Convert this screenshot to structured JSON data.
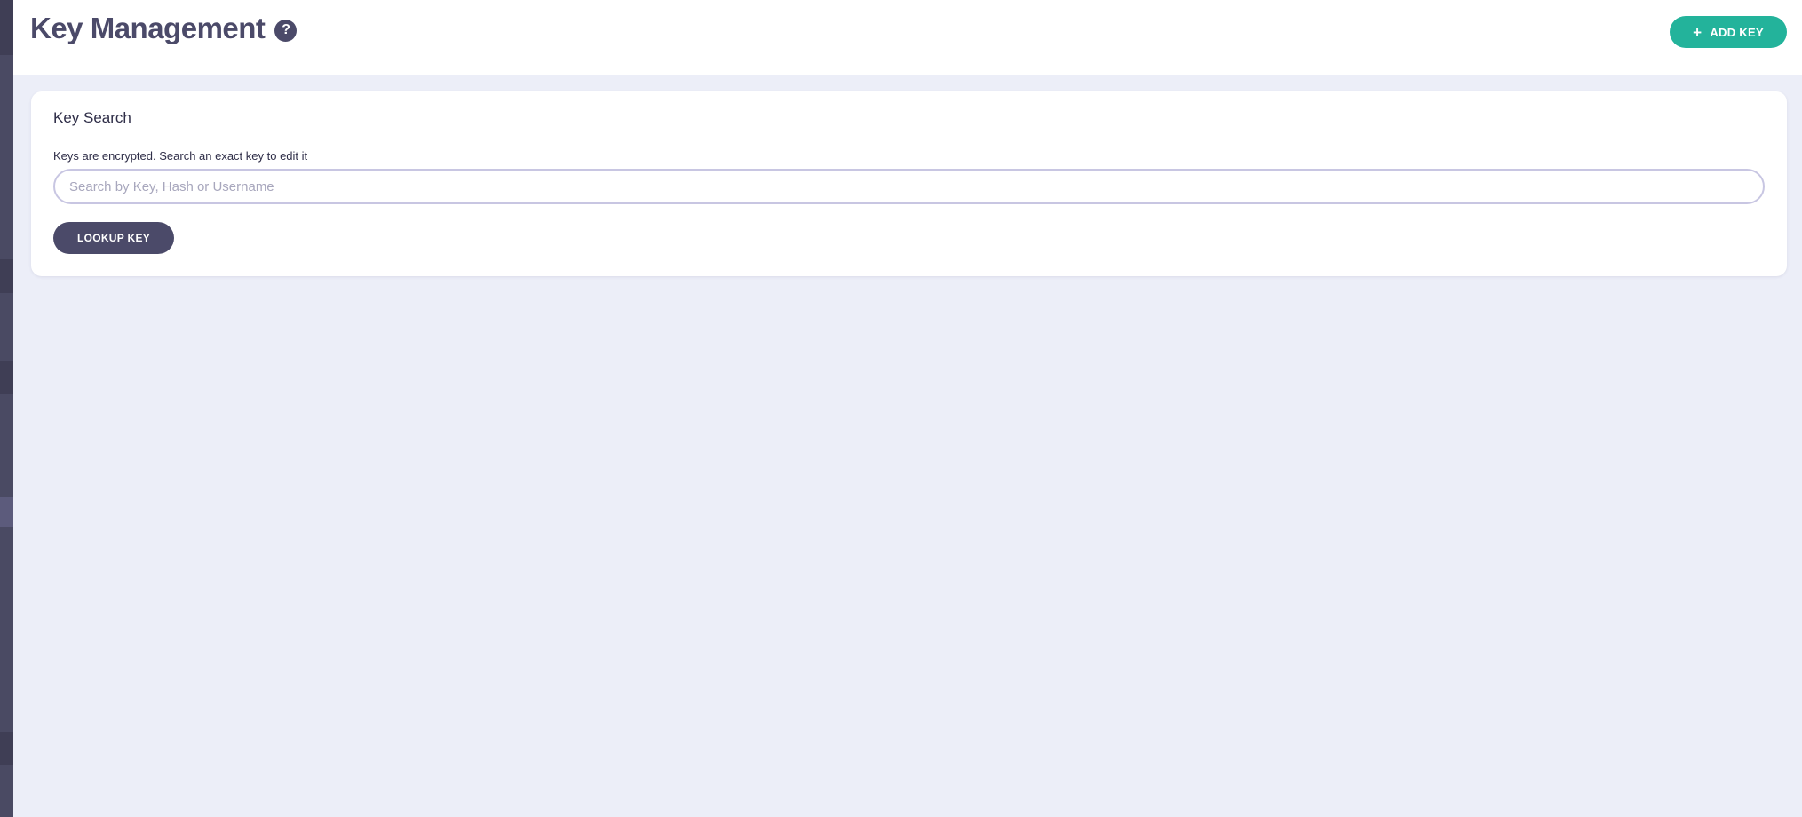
{
  "header": {
    "title": "Key Management",
    "help_icon": "question-circle-icon",
    "add_key_label": "ADD KEY",
    "add_key_icon": "plus-icon"
  },
  "key_search": {
    "title": "Key Search",
    "label": "Keys are encrypted. Search an exact key to edit it",
    "placeholder": "Search by Key, Hash or Username",
    "value": "",
    "button_label": "LOOKUP KEY"
  },
  "colors": {
    "primary_dark": "#4b4a69",
    "accent_green": "#23b39b",
    "background": "#eceef8",
    "sidebar": "#4a4a63"
  }
}
